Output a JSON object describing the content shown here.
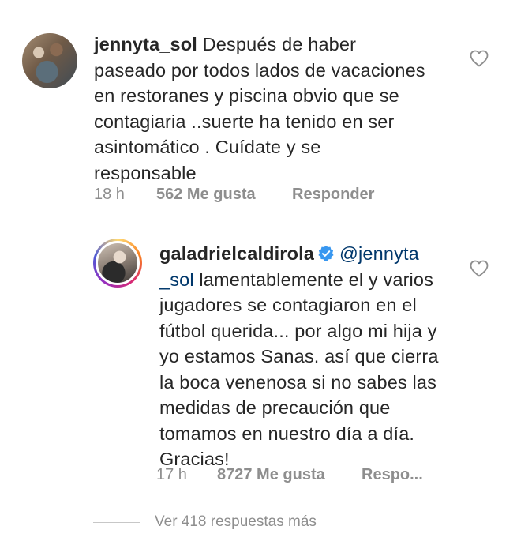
{
  "comments": [
    {
      "username": "jennyta_sol",
      "text": "Después de haber paseado por todos lados de vacaciones en restoranes y piscina obvio que se contagiaria ..suerte ha tenido en ser asintomático . Cuídate y se responsable",
      "time": "18 h",
      "likes": "562 Me gusta",
      "reply": "Responder"
    },
    {
      "username": "galadrielcaldirola",
      "verified": true,
      "mention": "@jennyta _sol",
      "text": "lamentablemente el y varios jugadores se contagiaron en el fútbol querida... por algo mi hija y yo estamos Sanas. así que cierra la boca venenosa si no sabes las medidas de precaución que tomamos en nuestro día a día. Gracias!",
      "time": "17 h",
      "likes": "8727 Me gusta",
      "reply": "Respo..."
    }
  ],
  "view_more": "Ver 418 respuestas más",
  "colors": {
    "text": "#262626",
    "secondary": "#8e8e8e",
    "mention": "#00376b",
    "verified": "#3897f0"
  },
  "icons": {
    "like": "heart-outline-icon",
    "verified": "verified-badge-icon"
  }
}
